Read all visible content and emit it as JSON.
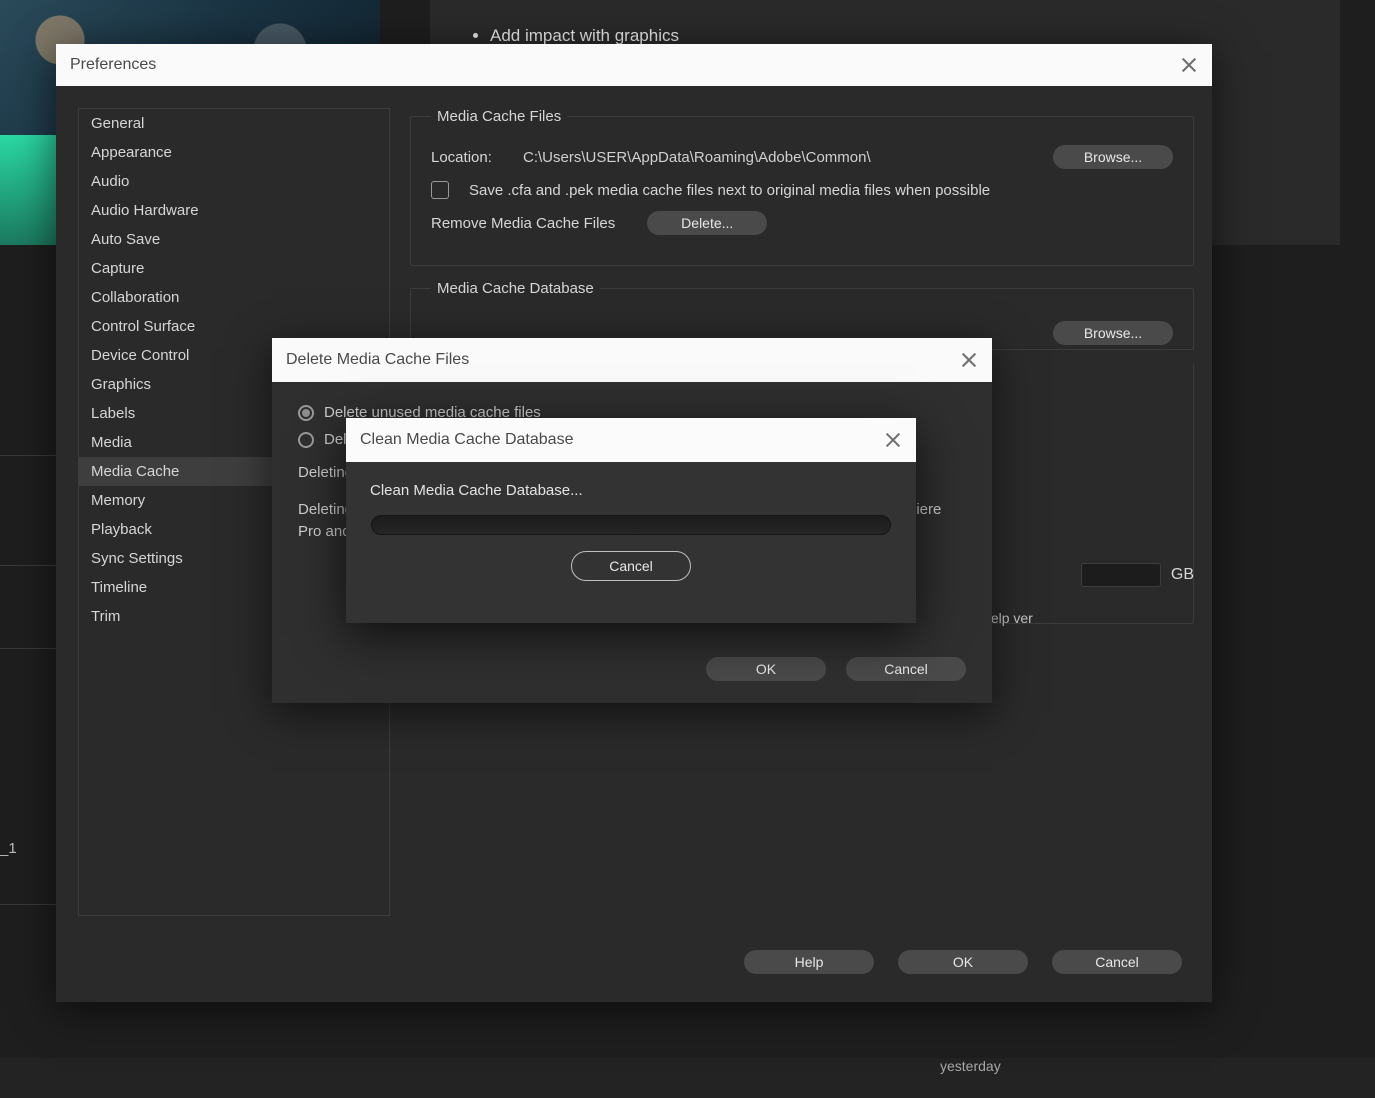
{
  "background": {
    "bullet": "Add impact with graphics",
    "clip_label": "_1",
    "timeline_footer": "yesterday"
  },
  "prefs": {
    "title": "Preferences",
    "sidebar": [
      "General",
      "Appearance",
      "Audio",
      "Audio Hardware",
      "Auto Save",
      "Capture",
      "Collaboration",
      "Control Surface",
      "Device Control",
      "Graphics",
      "Labels",
      "Media",
      "Media Cache",
      "Memory",
      "Playback",
      "Sync Settings",
      "Timeline",
      "Trim"
    ],
    "selected_index": 12,
    "cache_files": {
      "legend": "Media Cache Files",
      "location_label": "Location:",
      "location_path": "C:\\Users\\USER\\AppData\\Roaming\\Adobe\\Common\\",
      "browse": "Browse...",
      "save_cfa_pek": "Save .cfa and .pek media cache files next to original media files when possible",
      "remove_label": "Remove Media Cache Files",
      "delete_btn": "Delete..."
    },
    "cache_db": {
      "legend": "Media Cache Database",
      "browse": "Browse..."
    },
    "gb_unit": "GB",
    "hint_text": "back of help ver",
    "footer": {
      "help": "Help",
      "ok": "OK",
      "cancel": "Cancel"
    }
  },
  "delete_dlg": {
    "title": "Delete Media Cache Files",
    "radio1": "Delete unused media cache files",
    "radio2": "Delete all media cache files",
    "para1": "Deleting unused media cache files removes files that can no longer be used.",
    "para2": "Deleting all media cache files removes all cached cache files. To use this option, restart Premiere Pro and select this prior to opening any project.",
    "ok": "OK",
    "cancel": "Cancel"
  },
  "clean_dlg": {
    "title": "Clean Media Cache Database",
    "message": "Clean Media Cache Database...",
    "cancel": "Cancel"
  }
}
